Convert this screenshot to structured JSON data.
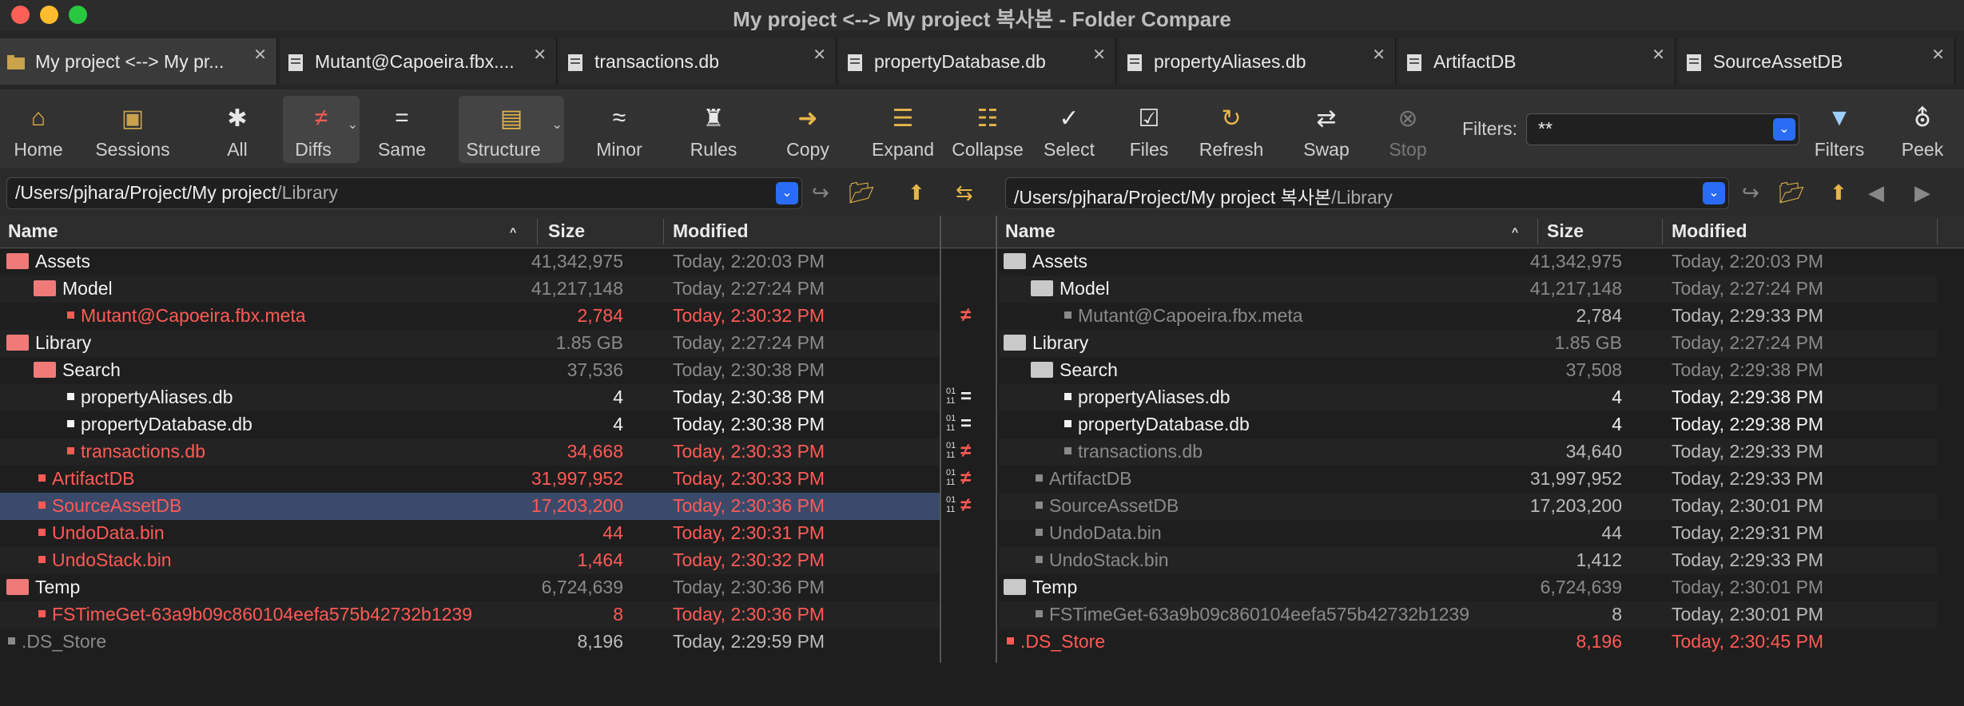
{
  "window": {
    "title": "My project <--> My project 복사본 - Folder Compare"
  },
  "tabs": [
    {
      "label": "My project <--> My pr...",
      "close": "✕"
    },
    {
      "label": "Mutant@Capoeira.fbx....",
      "close": "✕"
    },
    {
      "label": "transactions.db",
      "close": "✕"
    },
    {
      "label": "propertyDatabase.db",
      "close": "✕"
    },
    {
      "label": "propertyAliases.db",
      "close": "✕"
    },
    {
      "label": "ArtifactDB",
      "close": "✕"
    },
    {
      "label": "SourceAssetDB",
      "close": "✕"
    }
  ],
  "toolbar": {
    "home": "Home",
    "sessions": "Sessions",
    "all": "All",
    "diffs": "Diffs",
    "same": "Same",
    "structure": "Structure",
    "minor": "Minor",
    "rules": "Rules",
    "copy": "Copy",
    "expand": "Expand",
    "collapse": "Collapse",
    "select": "Select",
    "files": "Files",
    "refresh": "Refresh",
    "swap": "Swap",
    "stop": "Stop",
    "filters_label": "Filters:",
    "filters_value": "**",
    "filters_btn": "Filters",
    "peek": "Peek"
  },
  "left": {
    "path_main": "/Users/pjhara/Project/My project",
    "path_sub": "/Library",
    "col_name": "Name",
    "col_size": "Size",
    "col_modified": "Modified",
    "rows": [
      {
        "name": "Assets",
        "size": "41,342,975",
        "modified": "Today, 2:20:03 PM"
      },
      {
        "name": "Model",
        "size": "41,217,148",
        "modified": "Today, 2:27:24 PM"
      },
      {
        "name": "Mutant@Capoeira.fbx.meta",
        "size": "2,784",
        "modified": "Today, 2:30:32 PM"
      },
      {
        "name": "Library",
        "size": "1.85 GB",
        "modified": "Today, 2:27:24 PM"
      },
      {
        "name": "Search",
        "size": "37,536",
        "modified": "Today, 2:30:38 PM"
      },
      {
        "name": "propertyAliases.db",
        "size": "4",
        "modified": "Today, 2:30:38 PM"
      },
      {
        "name": "propertyDatabase.db",
        "size": "4",
        "modified": "Today, 2:30:38 PM"
      },
      {
        "name": "transactions.db",
        "size": "34,668",
        "modified": "Today, 2:30:33 PM"
      },
      {
        "name": "ArtifactDB",
        "size": "31,997,952",
        "modified": "Today, 2:30:33 PM"
      },
      {
        "name": "SourceAssetDB",
        "size": "17,203,200",
        "modified": "Today, 2:30:36 PM"
      },
      {
        "name": "UndoData.bin",
        "size": "44",
        "modified": "Today, 2:30:31 PM"
      },
      {
        "name": "UndoStack.bin",
        "size": "1,464",
        "modified": "Today, 2:30:32 PM"
      },
      {
        "name": "Temp",
        "size": "6,724,639",
        "modified": "Today, 2:30:36 PM"
      },
      {
        "name": "FSTimeGet-63a9b09c860104eefa575b42732b1239",
        "size": "8",
        "modified": "Today, 2:30:36 PM"
      },
      {
        "name": ".DS_Store",
        "size": "8,196",
        "modified": "Today, 2:29:59 PM"
      }
    ]
  },
  "right": {
    "path_main": "/Users/pjhara/Project/My project 복사본",
    "path_sub": "/Library",
    "col_name": "Name",
    "col_size": "Size",
    "col_modified": "Modified",
    "rows": [
      {
        "name": "Assets",
        "size": "41,342,975",
        "modified": "Today, 2:20:03 PM"
      },
      {
        "name": "Model",
        "size": "41,217,148",
        "modified": "Today, 2:27:24 PM"
      },
      {
        "name": "Mutant@Capoeira.fbx.meta",
        "size": "2,784",
        "modified": "Today, 2:29:33 PM"
      },
      {
        "name": "Library",
        "size": "1.85 GB",
        "modified": "Today, 2:27:24 PM"
      },
      {
        "name": "Search",
        "size": "37,508",
        "modified": "Today, 2:29:38 PM"
      },
      {
        "name": "propertyAliases.db",
        "size": "4",
        "modified": "Today, 2:29:38 PM"
      },
      {
        "name": "propertyDatabase.db",
        "size": "4",
        "modified": "Today, 2:29:38 PM"
      },
      {
        "name": "transactions.db",
        "size": "34,640",
        "modified": "Today, 2:29:33 PM"
      },
      {
        "name": "ArtifactDB",
        "size": "31,997,952",
        "modified": "Today, 2:29:33 PM"
      },
      {
        "name": "SourceAssetDB",
        "size": "17,203,200",
        "modified": "Today, 2:30:01 PM"
      },
      {
        "name": "UndoData.bin",
        "size": "44",
        "modified": "Today, 2:29:31 PM"
      },
      {
        "name": "UndoStack.bin",
        "size": "1,412",
        "modified": "Today, 2:29:33 PM"
      },
      {
        "name": "Temp",
        "size": "6,724,639",
        "modified": "Today, 2:30:01 PM"
      },
      {
        "name": "FSTimeGet-63a9b09c860104eefa575b42732b1239",
        "size": "8",
        "modified": "Today, 2:30:01 PM"
      },
      {
        "name": ".DS_Store",
        "size": "8,196",
        "modified": "Today, 2:30:45 PM"
      }
    ]
  },
  "diff_marks": {
    "not_equal": "≠",
    "equal": "=",
    "bits_top": "01",
    "bits_bottom": "11"
  },
  "colors": {
    "diff": "#ff5a55",
    "selected_row": "#3b4a6b",
    "accent": "#2a6df4"
  }
}
